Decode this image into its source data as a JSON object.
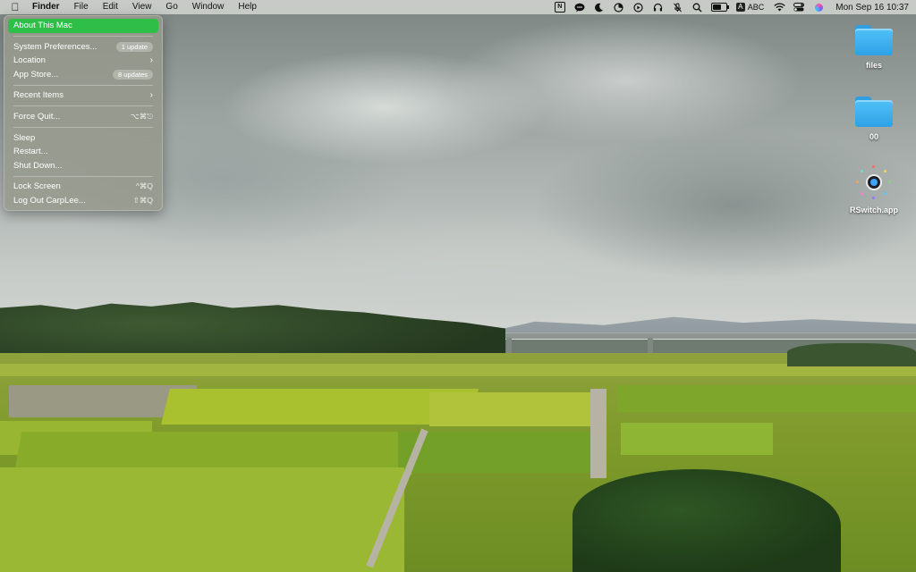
{
  "menubar": {
    "app_name": "Finder",
    "menus": [
      "File",
      "Edit",
      "View",
      "Go",
      "Window",
      "Help"
    ],
    "status_icons": [
      "notion-icon",
      "wechat-icon",
      "do-not-disturb-icon",
      "timer-icon",
      "play-icon",
      "headphones-icon",
      "mute-mic-icon",
      "search-icon",
      "battery-icon"
    ],
    "input_source": "ABC",
    "input_source_badge": "A",
    "notion_badge": "N",
    "clock": "Mon Sep 16  10:37"
  },
  "apple_menu": {
    "items": [
      {
        "label": "About This Mac",
        "highlighted": true
      },
      {
        "label": "System Preferences...",
        "badge": "1 update"
      },
      {
        "label": "Location",
        "submenu": true
      },
      {
        "label": "App Store...",
        "badge": "8 updates"
      },
      {
        "label": "Recent Items",
        "submenu": true
      },
      {
        "label": "Force Quit...",
        "shortcut": "⌥⌘⎋"
      },
      {
        "label": "Sleep"
      },
      {
        "label": "Restart..."
      },
      {
        "label": "Shut Down..."
      },
      {
        "label": "Lock Screen",
        "shortcut": "^⌘Q"
      },
      {
        "label": "Log Out CarpLee...",
        "shortcut": "⇧⌘Q"
      }
    ]
  },
  "desktop": {
    "icons": [
      {
        "label": "files",
        "type": "folder"
      },
      {
        "label": "00",
        "type": "folder"
      },
      {
        "label": "RSwitch.app",
        "type": "app"
      }
    ]
  },
  "colors": {
    "menu_highlight": "#2fbf48",
    "folder_blue": "#3db0f0"
  }
}
